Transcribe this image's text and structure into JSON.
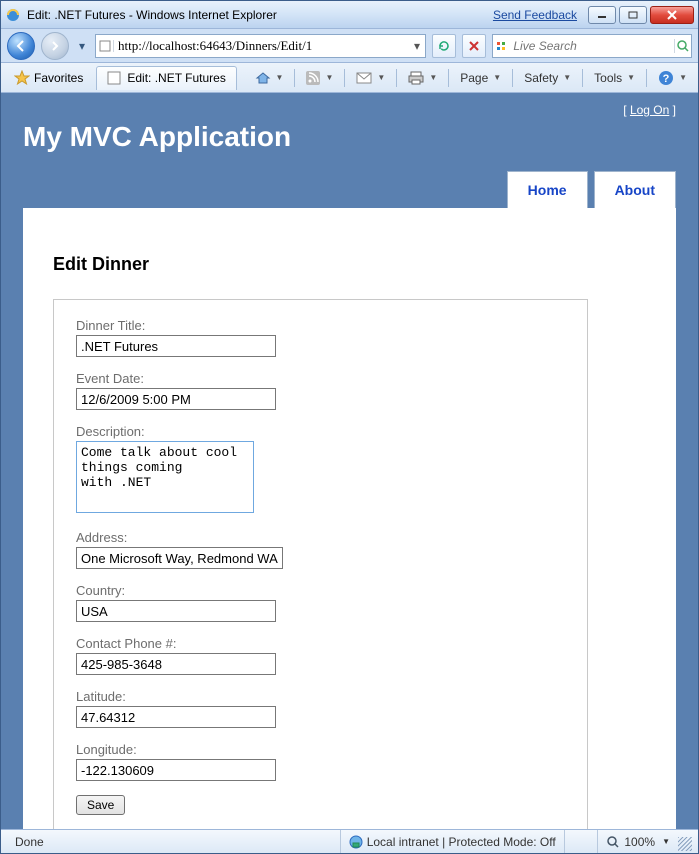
{
  "window": {
    "title": "Edit: .NET Futures - Windows Internet Explorer",
    "feedback": "Send Feedback"
  },
  "nav": {
    "url": "http://localhost:64643/Dinners/Edit/1",
    "search_placeholder": "Live Search"
  },
  "favorites": {
    "label": "Favorites",
    "tab_title": "Edit: .NET Futures"
  },
  "commands": {
    "page": "Page",
    "safety": "Safety",
    "tools": "Tools"
  },
  "app": {
    "logon": "Log On",
    "title": "My MVC Application",
    "menu": {
      "home": "Home",
      "about": "About"
    }
  },
  "page": {
    "heading": "Edit Dinner",
    "fields": {
      "title_label": "Dinner Title:",
      "title_value": ".NET Futures",
      "date_label": "Event Date:",
      "date_value": "12/6/2009 5:00 PM",
      "desc_label": "Description:",
      "desc_value": "Come talk about cool things coming\nwith .NET",
      "addr_label": "Address:",
      "addr_value": "One Microsoft Way, Redmond WA",
      "country_label": "Country:",
      "country_value": "USA",
      "phone_label": "Contact Phone #:",
      "phone_value": "425-985-3648",
      "lat_label": "Latitude:",
      "lat_value": "47.64312",
      "lon_label": "Longitude:",
      "lon_value": "-122.130609"
    },
    "save": "Save"
  },
  "status": {
    "done": "Done",
    "zone": "Local intranet | Protected Mode: Off",
    "zoom": "100%"
  }
}
